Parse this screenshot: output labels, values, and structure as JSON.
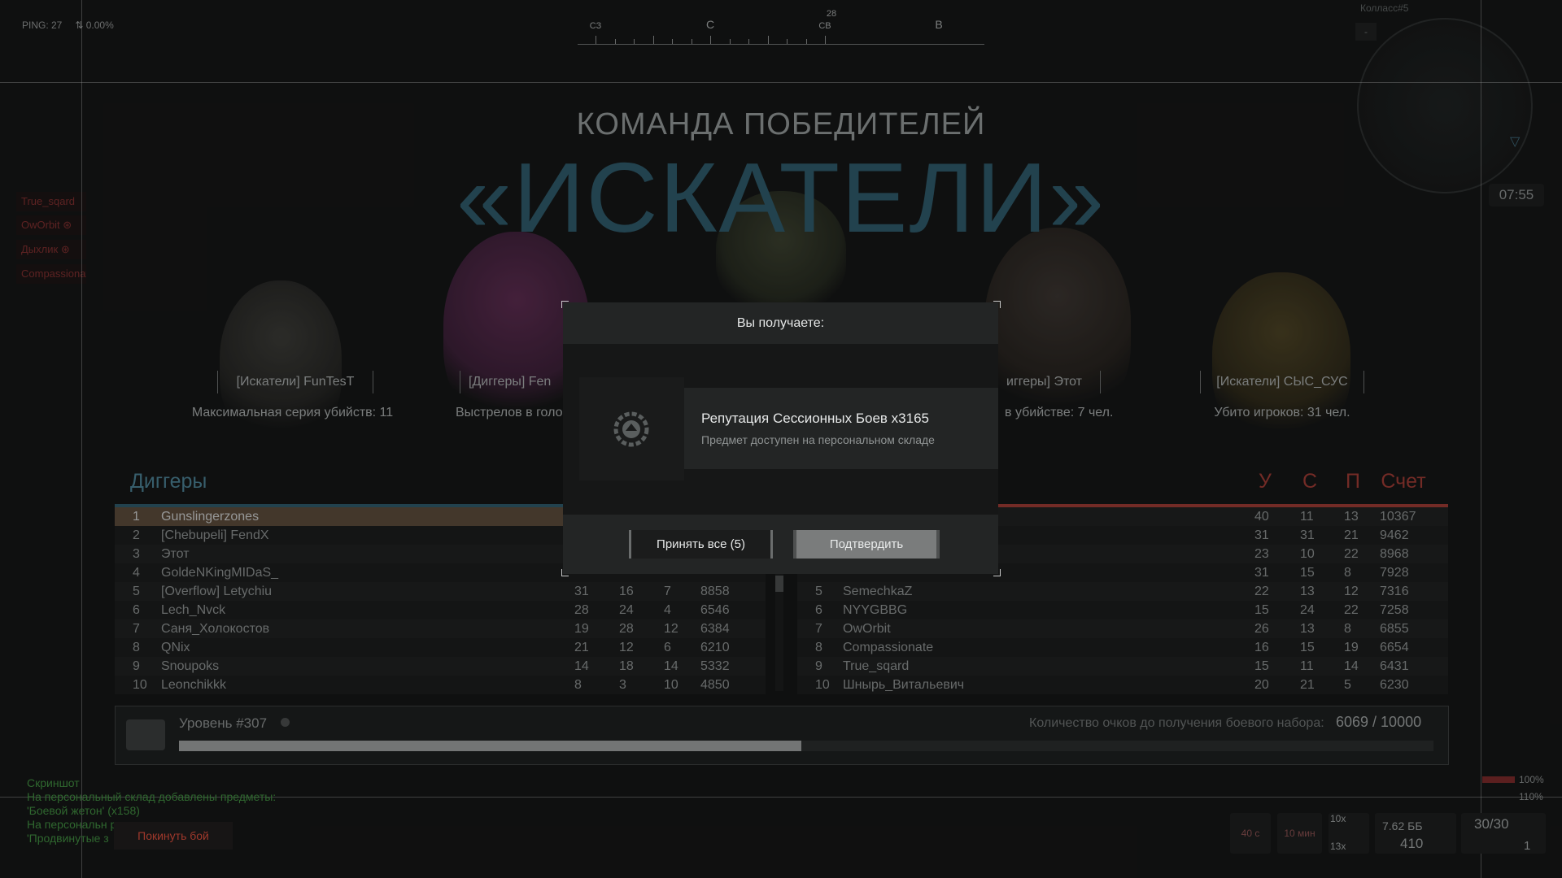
{
  "hud": {
    "ping": "PING: 27",
    "loss": "0.00%",
    "compass": {
      "heading": "28",
      "labels": [
        {
          "text": "СЗ",
          "small": true
        },
        {
          "text": "С",
          "small": false
        },
        {
          "text": "СВ",
          "small": true
        },
        {
          "text": "В",
          "small": false
        }
      ]
    },
    "squad_label": "Колласс#5",
    "timer": "07:55",
    "squad": [
      "True_sqard",
      "OwOrbit",
      "Дыхлик",
      "Compassionate"
    ]
  },
  "title": {
    "subtitle": "КОМАНДА ПОБЕДИТЕЛЕЙ",
    "team": "«ИСКАТЕЛИ»"
  },
  "mvp_cards": [
    {
      "name": "[Искатели] FunTesT",
      "stat": "Максимальная серия убийств: 11"
    },
    {
      "name": "[Диггеры] Fen",
      "stat": "Выстрелов в голо"
    },
    {
      "name": "иггеры] Этот",
      "stat": "в убийстве: 7 чел."
    },
    {
      "name": "[Искатели] СЫС_СУС",
      "stat": "Убито игроков: 31 чел."
    }
  ],
  "scoreboard": {
    "left_team": "Диггеры",
    "columns": [
      "У",
      "С",
      "П",
      "Счет"
    ],
    "left_rows": [
      {
        "rank": "1",
        "name": "Gunslingerzones",
        "k": "",
        "d": "",
        "a": "",
        "score": ""
      },
      {
        "rank": "2",
        "name": "[Chebupeli] FendX",
        "k": "",
        "d": "",
        "a": "",
        "score": ""
      },
      {
        "rank": "3",
        "name": "Этот",
        "k": "",
        "d": "",
        "a": "",
        "score": ""
      },
      {
        "rank": "4",
        "name": "GoldeNKingMIDaS_",
        "k": "",
        "d": "",
        "a": "",
        "score": ""
      },
      {
        "rank": "5",
        "name": "[Overflow] Letychiu",
        "k": "31",
        "d": "16",
        "a": "7",
        "score": "8858"
      },
      {
        "rank": "6",
        "name": "Lech_Nvck",
        "k": "28",
        "d": "24",
        "a": "4",
        "score": "6546"
      },
      {
        "rank": "7",
        "name": "Саня_Холокостов",
        "k": "19",
        "d": "28",
        "a": "12",
        "score": "6384"
      },
      {
        "rank": "8",
        "name": "QNix",
        "k": "21",
        "d": "12",
        "a": "6",
        "score": "6210"
      },
      {
        "rank": "9",
        "name": "Snoupoks",
        "k": "14",
        "d": "18",
        "a": "14",
        "score": "5332"
      },
      {
        "rank": "10",
        "name": "Leonchikkk",
        "k": "8",
        "d": "3",
        "a": "10",
        "score": "4850"
      }
    ],
    "right_rows": [
      {
        "rank": "",
        "name": "",
        "k": "40",
        "d": "11",
        "a": "13",
        "score": "10367"
      },
      {
        "rank": "",
        "name": "",
        "k": "31",
        "d": "31",
        "a": "21",
        "score": "9462"
      },
      {
        "rank": "",
        "name": "",
        "k": "23",
        "d": "10",
        "a": "22",
        "score": "8968"
      },
      {
        "rank": "",
        "name": "",
        "k": "31",
        "d": "15",
        "a": "8",
        "score": "7928"
      },
      {
        "rank": "5",
        "name": "SemechkaZ",
        "k": "22",
        "d": "13",
        "a": "12",
        "score": "7316"
      },
      {
        "rank": "6",
        "name": "NYYGBBG",
        "k": "15",
        "d": "24",
        "a": "22",
        "score": "7258"
      },
      {
        "rank": "7",
        "name": "OwOrbit",
        "k": "26",
        "d": "13",
        "a": "8",
        "score": "6855"
      },
      {
        "rank": "8",
        "name": "Compassionate",
        "k": "16",
        "d": "15",
        "a": "19",
        "score": "6654"
      },
      {
        "rank": "9",
        "name": "True_sqard",
        "k": "15",
        "d": "11",
        "a": "14",
        "score": "6431"
      },
      {
        "rank": "10",
        "name": "Шнырь_Витальевич",
        "k": "20",
        "d": "21",
        "a": "5",
        "score": "6230"
      }
    ]
  },
  "level": {
    "label": "Уровень #307",
    "points_label": "Количество очков до получения боевого набора:",
    "points_value": "6069 / 10000",
    "progress": 0.496
  },
  "modal": {
    "header": "Вы получаете:",
    "item_name": "Репутация Сессионных Боев x3165",
    "item_desc": "Предмет доступен на персональном складе",
    "accept_all": "Принять все (5)",
    "confirm": "Подтвердить"
  },
  "chat": [
    "Скриншот",
    "На персональный склад добавлены предметы:",
    "'Боевой жетон' (x158)",
    "На персональн                  редметы:",
    "'Продвинутые з"
  ],
  "leave_button": "Покинуть бой",
  "bottom_hud": {
    "cooldown1": "40 с",
    "cooldown2": "10 мин",
    "x10": "10x",
    "x13": "13x",
    "ammo_type": "7.62 ББ",
    "ammo_reserve": "410",
    "ammo_count": "30/30",
    "grenades": "1",
    "health": "100%",
    "armor": "110%"
  },
  "colors": {
    "team_blue": "#2e5868",
    "team_red": "#9a3a33",
    "highlight_row": "#5a4a3a"
  }
}
